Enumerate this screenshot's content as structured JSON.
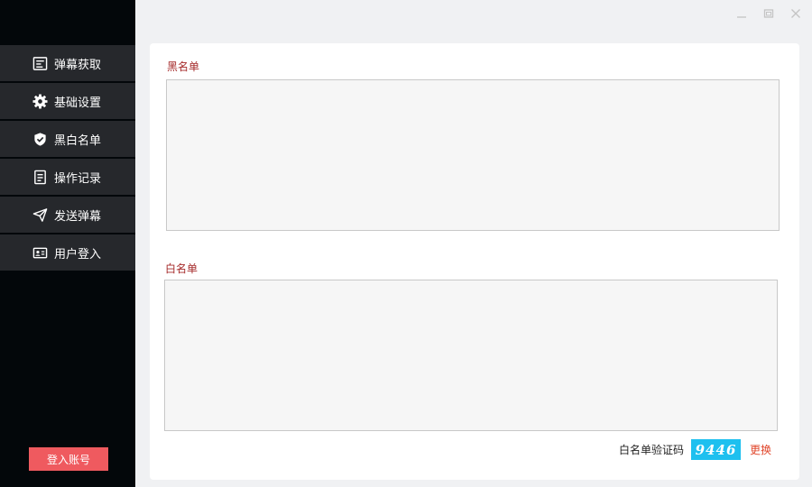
{
  "sidebar": {
    "items": [
      {
        "label": "弹幕获取",
        "icon": "list-icon"
      },
      {
        "label": "基础设置",
        "icon": "gear-icon"
      },
      {
        "label": "黑白名单",
        "icon": "shield-icon"
      },
      {
        "label": "操作记录",
        "icon": "document-icon"
      },
      {
        "label": "发送弹幕",
        "icon": "paper-plane-icon"
      },
      {
        "label": "用户登入",
        "icon": "id-card-icon"
      }
    ],
    "login_button": "登入账号"
  },
  "blacklist": {
    "label": "黑名单",
    "value": ""
  },
  "whitelist": {
    "label": "白名单",
    "value": ""
  },
  "captcha": {
    "label": "白名单验证码",
    "code": "9446",
    "refresh": "更换"
  },
  "colors": {
    "accent": "#ef5a5f",
    "label_red": "#a52a2a",
    "captcha_bg": "#1ec0ef",
    "sidebar_bg": "#03070a",
    "nav_item_bg": "#26282c"
  }
}
